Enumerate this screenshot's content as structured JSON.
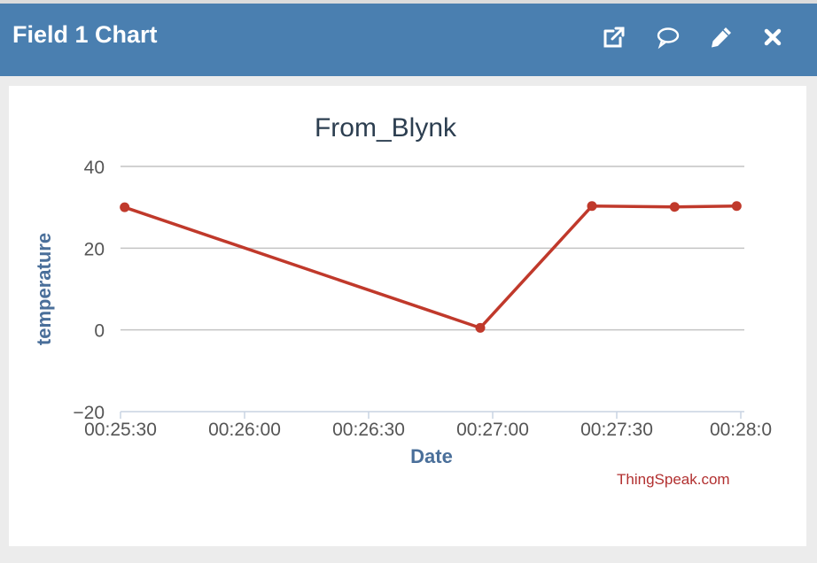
{
  "header": {
    "title": "Field 1 Chart",
    "icons": [
      "external-link-icon",
      "comment-icon",
      "pencil-icon",
      "close-icon"
    ]
  },
  "colors": {
    "header": "#4a7fb0",
    "series": "#c0392b",
    "axis_label": "#4a6f9a",
    "credit": "#b23030"
  },
  "credit": "ThingSpeak.com",
  "chart_data": {
    "type": "line",
    "title": "From_Blynk",
    "xlabel": "Date",
    "ylabel": "temperature",
    "ylim": [
      -20,
      40
    ],
    "yticks": [
      -20,
      0,
      20,
      40
    ],
    "ytick_labels": [
      "−20",
      "0",
      "20",
      "40"
    ],
    "xlim": [
      "00:25:30",
      "00:28:00"
    ],
    "xticks": [
      "00:25:30",
      "00:26:00",
      "00:26:30",
      "00:27:00",
      "00:27:30",
      "00:28:00"
    ],
    "xtick_labels": [
      "00:25:30",
      "00:26:00",
      "00:26:30",
      "00:27:00",
      "00:27:30",
      "00:28:0"
    ],
    "grid": true,
    "series": [
      {
        "x": [
          "00:25:31",
          "00:26:57",
          "00:27:24",
          "00:27:44",
          "00:27:59"
        ],
        "y": [
          30,
          0.5,
          30.3,
          30.1,
          30.3
        ]
      }
    ]
  }
}
